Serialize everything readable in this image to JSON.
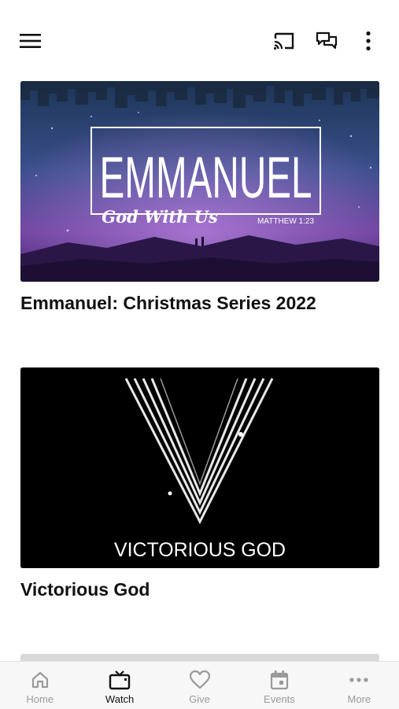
{
  "header": {
    "menu_icon": "hamburger-menu-icon",
    "cast_icon": "cast-icon",
    "chat_icon": "chat-bubbles-icon",
    "more_icon": "vertical-dots-icon"
  },
  "cards": [
    {
      "title": "Emmanuel: Christmas Series 2022",
      "art_title": "EMMANUEL",
      "art_subtitle": "God With Us",
      "art_reference": "MATTHEW 1:23"
    },
    {
      "title": "Victorious God",
      "art_title": "VICTORIOUS GOD"
    }
  ],
  "tabs": [
    {
      "label": "Home",
      "icon": "home-icon",
      "active": false
    },
    {
      "label": "Watch",
      "icon": "tv-icon",
      "active": true
    },
    {
      "label": "Give",
      "icon": "heart-icon",
      "active": false
    },
    {
      "label": "Events",
      "icon": "calendar-icon",
      "active": false
    },
    {
      "label": "More",
      "icon": "horizontal-dots-icon",
      "active": false
    }
  ],
  "colors": {
    "active_tab": "#111111",
    "inactive_tab": "#9a9a9a"
  }
}
